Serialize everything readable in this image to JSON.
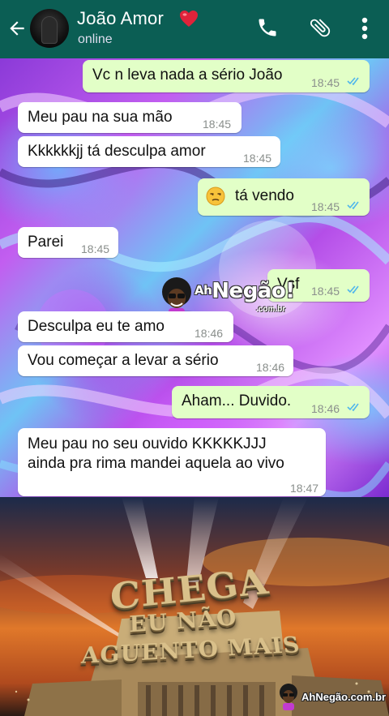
{
  "header": {
    "contact_name": "João Amor",
    "status": "online",
    "icons": [
      "back-arrow-icon",
      "heart-icon",
      "phone-icon",
      "paperclip-icon",
      "more-vert-icon"
    ]
  },
  "messages": [
    {
      "dir": "out",
      "text": "Vc n leva nada a sério João",
      "time": "18:45",
      "ticks": "read"
    },
    {
      "dir": "in",
      "text": "Meu pau na sua mão",
      "time": "18:45"
    },
    {
      "dir": "in",
      "text": "Kkkkkkjj tá desculpa amor",
      "time": "18:45"
    },
    {
      "dir": "out",
      "text": "tá vendo",
      "emoji": "unamused-face-icon",
      "time": "18:45",
      "ticks": "read"
    },
    {
      "dir": "in",
      "text": "Parei",
      "time": "18:45"
    },
    {
      "dir": "out",
      "text": "Vsf",
      "time": "18:45",
      "ticks": "read"
    },
    {
      "dir": "in",
      "text": "Desculpa eu te amo",
      "time": "18:46"
    },
    {
      "dir": "in",
      "text": "Vou começar a levar a sério",
      "time": "18:46"
    },
    {
      "dir": "out",
      "text": "Aham... Duvido.",
      "time": "18:46",
      "ticks": "read"
    },
    {
      "dir": "in",
      "line1": "Meu pau no seu ouvido KKKKKJJJ",
      "line2": "ainda pra rima mandei aquela ao vivo",
      "time": "18:47"
    }
  ],
  "watermark": {
    "prefix": "Ah",
    "brand": "Negão!",
    "suffix": ".com.br"
  },
  "meme": {
    "line1": "CHEGA",
    "line2": "EU NÃO",
    "line3": "AGUENTO MAIS"
  },
  "footer_watermark": "AhNegão.com.br",
  "colors": {
    "header": "#0b5e54",
    "incoming_bubble": "#ffffff",
    "outgoing_bubble": "#e2ffc7",
    "read_ticks": "#4fb6ec"
  }
}
